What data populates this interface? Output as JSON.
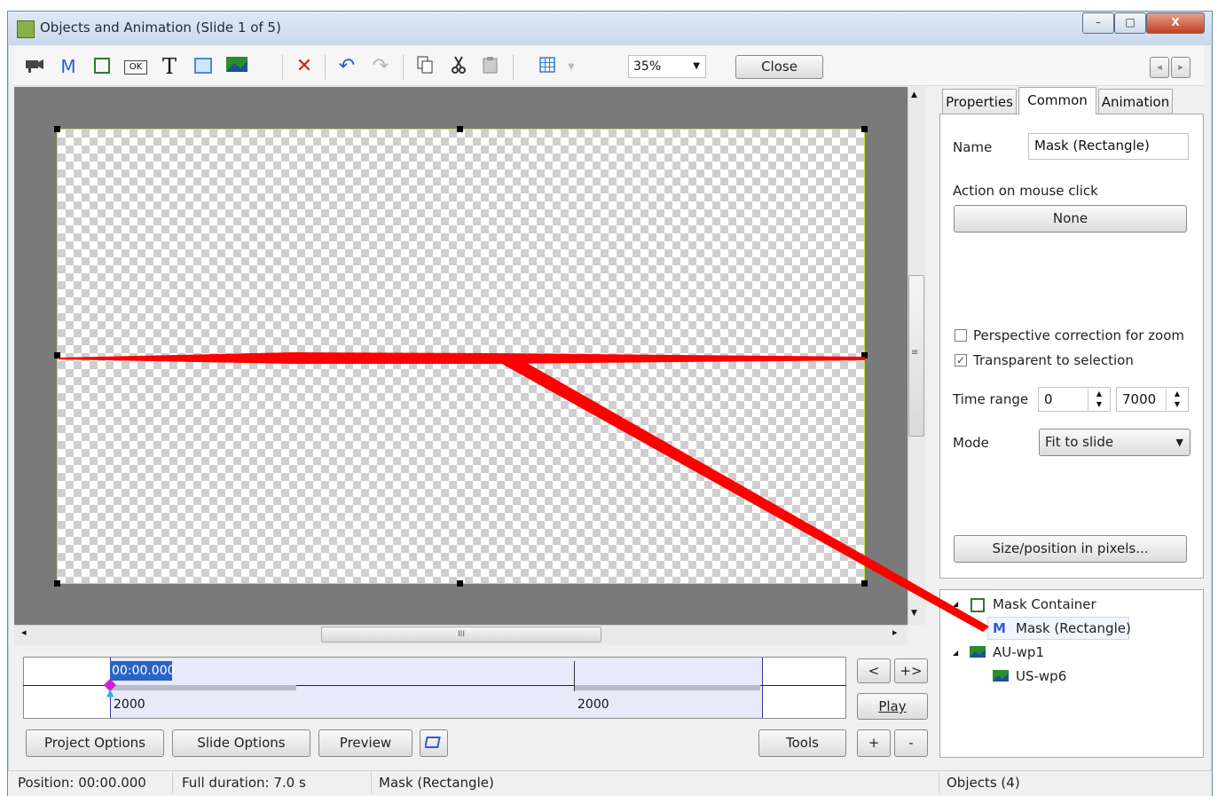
{
  "window": {
    "title": "Objects and Animation  (Slide 1 of 5)",
    "controls": {
      "minimize": "–",
      "maximize": "□",
      "close": "X"
    }
  },
  "toolbar": {
    "text_tool": "T",
    "mask_tool": "M",
    "button_tool": "OK",
    "delete": "✕",
    "undo": "↶",
    "redo": "↷",
    "zoom_value": "35%",
    "close_label": "Close",
    "nav_prev": "◂",
    "nav_next": "▸"
  },
  "scroll": {
    "up": "▲",
    "down": "▼",
    "left": "◂",
    "right": "▸",
    "grip": "≡",
    "hgrip": "III"
  },
  "timeline": {
    "current_time": "00:00.000",
    "marker_left": "2000",
    "marker_mid": "2000",
    "btn_prev": "<",
    "btn_next": "+>",
    "play_label": "Play",
    "add": "+",
    "remove": "-"
  },
  "bottom_buttons": {
    "project_options": "Project Options",
    "slide_options": "Slide Options",
    "preview": "Preview",
    "tools": "Tools"
  },
  "tabs": [
    "Properties",
    "Common",
    "Animation"
  ],
  "common": {
    "name_label": "Name",
    "name_value": "Mask (Rectangle)",
    "action_label": "Action on mouse click",
    "action_value": "None",
    "perspective_label": "Perspective correction for zoom",
    "perspective_checked": false,
    "transparent_label": "Transparent to selection",
    "transparent_checked": true,
    "time_range_label": "Time range",
    "time_from": "0",
    "time_to": "7000",
    "mode_label": "Mode",
    "mode_value": "Fit to slide",
    "size_button": "Size/position in pixels..."
  },
  "object_tree": [
    {
      "label": "Mask Container",
      "icon": "mask-container-icon"
    },
    {
      "label": "Mask (Rectangle)",
      "icon": "mask-m-icon"
    },
    {
      "label": "AU-wp1",
      "icon": "image-icon"
    },
    {
      "label": "US-wp6",
      "icon": "image-icon"
    }
  ],
  "tree_glyphs": {
    "m": "M",
    "expand": "◢"
  },
  "status": {
    "position": "Position:  00:00.000",
    "duration": "Full duration:  7.0 s",
    "selected": "Mask (Rectangle)",
    "objects": "Objects (4)"
  },
  "colors": {
    "annotation": "#ff0000",
    "selection": "#bfe23d",
    "timeline_sel": "#e8eaf9"
  }
}
